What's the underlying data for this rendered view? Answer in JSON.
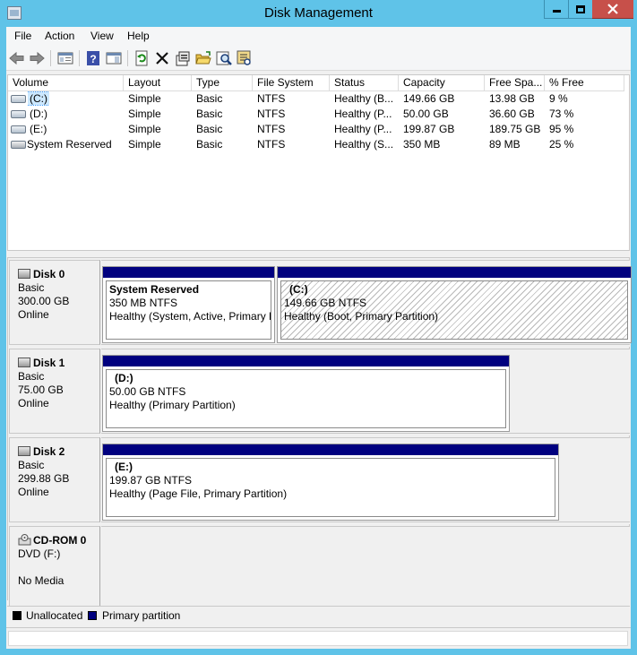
{
  "window": {
    "title": "Disk Management"
  },
  "menu": [
    "File",
    "Action",
    "View",
    "Help"
  ],
  "toolbar_icons": [
    "back-arrow-icon",
    "forward-arrow-icon",
    "show-hide-console-tree-icon",
    "help-icon",
    "properties-pane-icon",
    "refresh-icon",
    "delete-icon",
    "properties-icon",
    "open-folder-icon",
    "search-icon",
    "rescan-disks-icon"
  ],
  "volume_list": {
    "columns": [
      "Volume",
      "Layout",
      "Type",
      "File System",
      "Status",
      "Capacity",
      "Free Spa...",
      "% Free"
    ],
    "rows": [
      {
        "volume": "(C:)",
        "layout": "Simple",
        "type": "Basic",
        "fs": "NTFS",
        "status": "Healthy (B...",
        "capacity": "149.66 GB",
        "free": "13.98 GB",
        "pct": "9 %"
      },
      {
        "volume": "(D:)",
        "layout": "Simple",
        "type": "Basic",
        "fs": "NTFS",
        "status": "Healthy (P...",
        "capacity": "50.00 GB",
        "free": "36.60 GB",
        "pct": "73 %"
      },
      {
        "volume": "(E:)",
        "layout": "Simple",
        "type": "Basic",
        "fs": "NTFS",
        "status": "Healthy (P...",
        "capacity": "199.87 GB",
        "free": "189.75 GB",
        "pct": "95 %"
      },
      {
        "volume": "System Reserved",
        "layout": "Simple",
        "type": "Basic",
        "fs": "NTFS",
        "status": "Healthy (S...",
        "capacity": "350 MB",
        "free": "89 MB",
        "pct": "25 %"
      }
    ]
  },
  "disks": {
    "disk0": {
      "name": "Disk 0",
      "type": "Basic",
      "size": "300.00 GB",
      "state": "Online",
      "p1": {
        "name": "System Reserved",
        "size": "350 MB NTFS",
        "status": "Healthy (System, Active, Primary Partition)"
      },
      "p2": {
        "name": "(C:)",
        "size": "149.66 GB NTFS",
        "status": "Healthy (Boot, Primary Partition)"
      }
    },
    "disk1": {
      "name": "Disk 1",
      "type": "Basic",
      "size": "75.00 GB",
      "state": "Online",
      "p1": {
        "name": "(D:)",
        "size": "50.00 GB NTFS",
        "status": "Healthy (Primary Partition)"
      }
    },
    "disk2": {
      "name": "Disk 2",
      "type": "Basic",
      "size": "299.88 GB",
      "state": "Online",
      "p1": {
        "name": "(E:)",
        "size": "199.87 GB NTFS",
        "status": "Healthy (Page File, Primary Partition)"
      }
    },
    "cdrom0": {
      "name": "CD-ROM 0",
      "type": "DVD (F:)",
      "state": "No Media"
    }
  },
  "legend": {
    "unallocated": "Unallocated",
    "primary": "Primary partition"
  },
  "colors": {
    "primary_partition": "#00007f",
    "unallocated": "#000000",
    "title_bar": "#5fc3e8",
    "close_button": "#c7504a"
  }
}
